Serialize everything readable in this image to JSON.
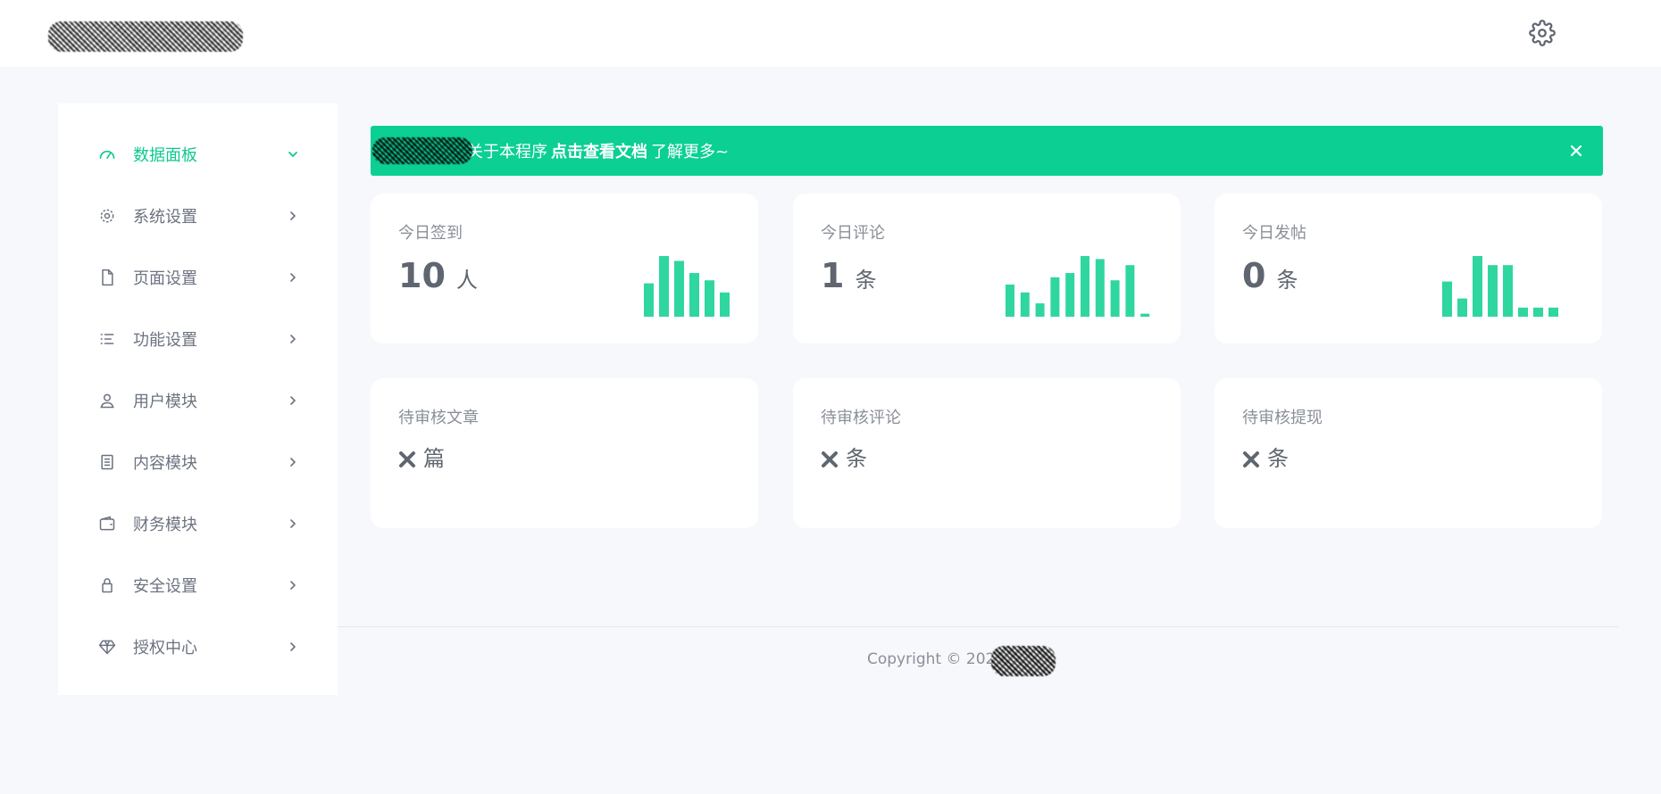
{
  "colors": {
    "accent": "#10c98f",
    "banner_bg": "#0ccf94",
    "bar": "#2fd6a0",
    "text": "#6b7280",
    "muted": "#8a8f98",
    "value": "#5f6670"
  },
  "header": {
    "settings_icon": "gear-icon"
  },
  "sidebar": {
    "items": [
      {
        "label": "数据面板",
        "icon": "dashboard-gauge-icon",
        "active": true
      },
      {
        "label": "系统设置",
        "icon": "gear-icon"
      },
      {
        "label": "页面设置",
        "icon": "file-icon"
      },
      {
        "label": "功能设置",
        "icon": "list-icon"
      },
      {
        "label": "用户模块",
        "icon": "user-icon"
      },
      {
        "label": "内容模块",
        "icon": "document-icon"
      },
      {
        "label": "财务模块",
        "icon": "wallet-icon"
      },
      {
        "label": "安全设置",
        "icon": "lock-icon"
      },
      {
        "label": "授权中心",
        "icon": "diamond-icon"
      }
    ]
  },
  "banner": {
    "prefix": "关于本程序",
    "link": "点击查看文档",
    "suffix": "了解更多~"
  },
  "stats": [
    {
      "title": "今日签到",
      "value": "10",
      "unit": "人",
      "bars": [
        0.55,
        1.0,
        0.92,
        0.72,
        0.6,
        0.4
      ]
    },
    {
      "title": "今日评论",
      "value": "1",
      "unit": "条",
      "bars": [
        0.53,
        0.4,
        0.22,
        0.65,
        0.72,
        1.0,
        0.95,
        0.6,
        0.85,
        0.05
      ]
    },
    {
      "title": "今日发帖",
      "value": "0",
      "unit": "条",
      "bars": [
        0.58,
        0.3,
        1.0,
        0.85,
        0.85,
        0.15,
        0.15,
        0.15
      ]
    }
  ],
  "pending": [
    {
      "title": "待审核文章",
      "unit": "篇"
    },
    {
      "title": "待审核评论",
      "unit": "条"
    },
    {
      "title": "待审核提现",
      "unit": "条"
    }
  ],
  "footer": {
    "copyright": "Copyright © 2023"
  }
}
